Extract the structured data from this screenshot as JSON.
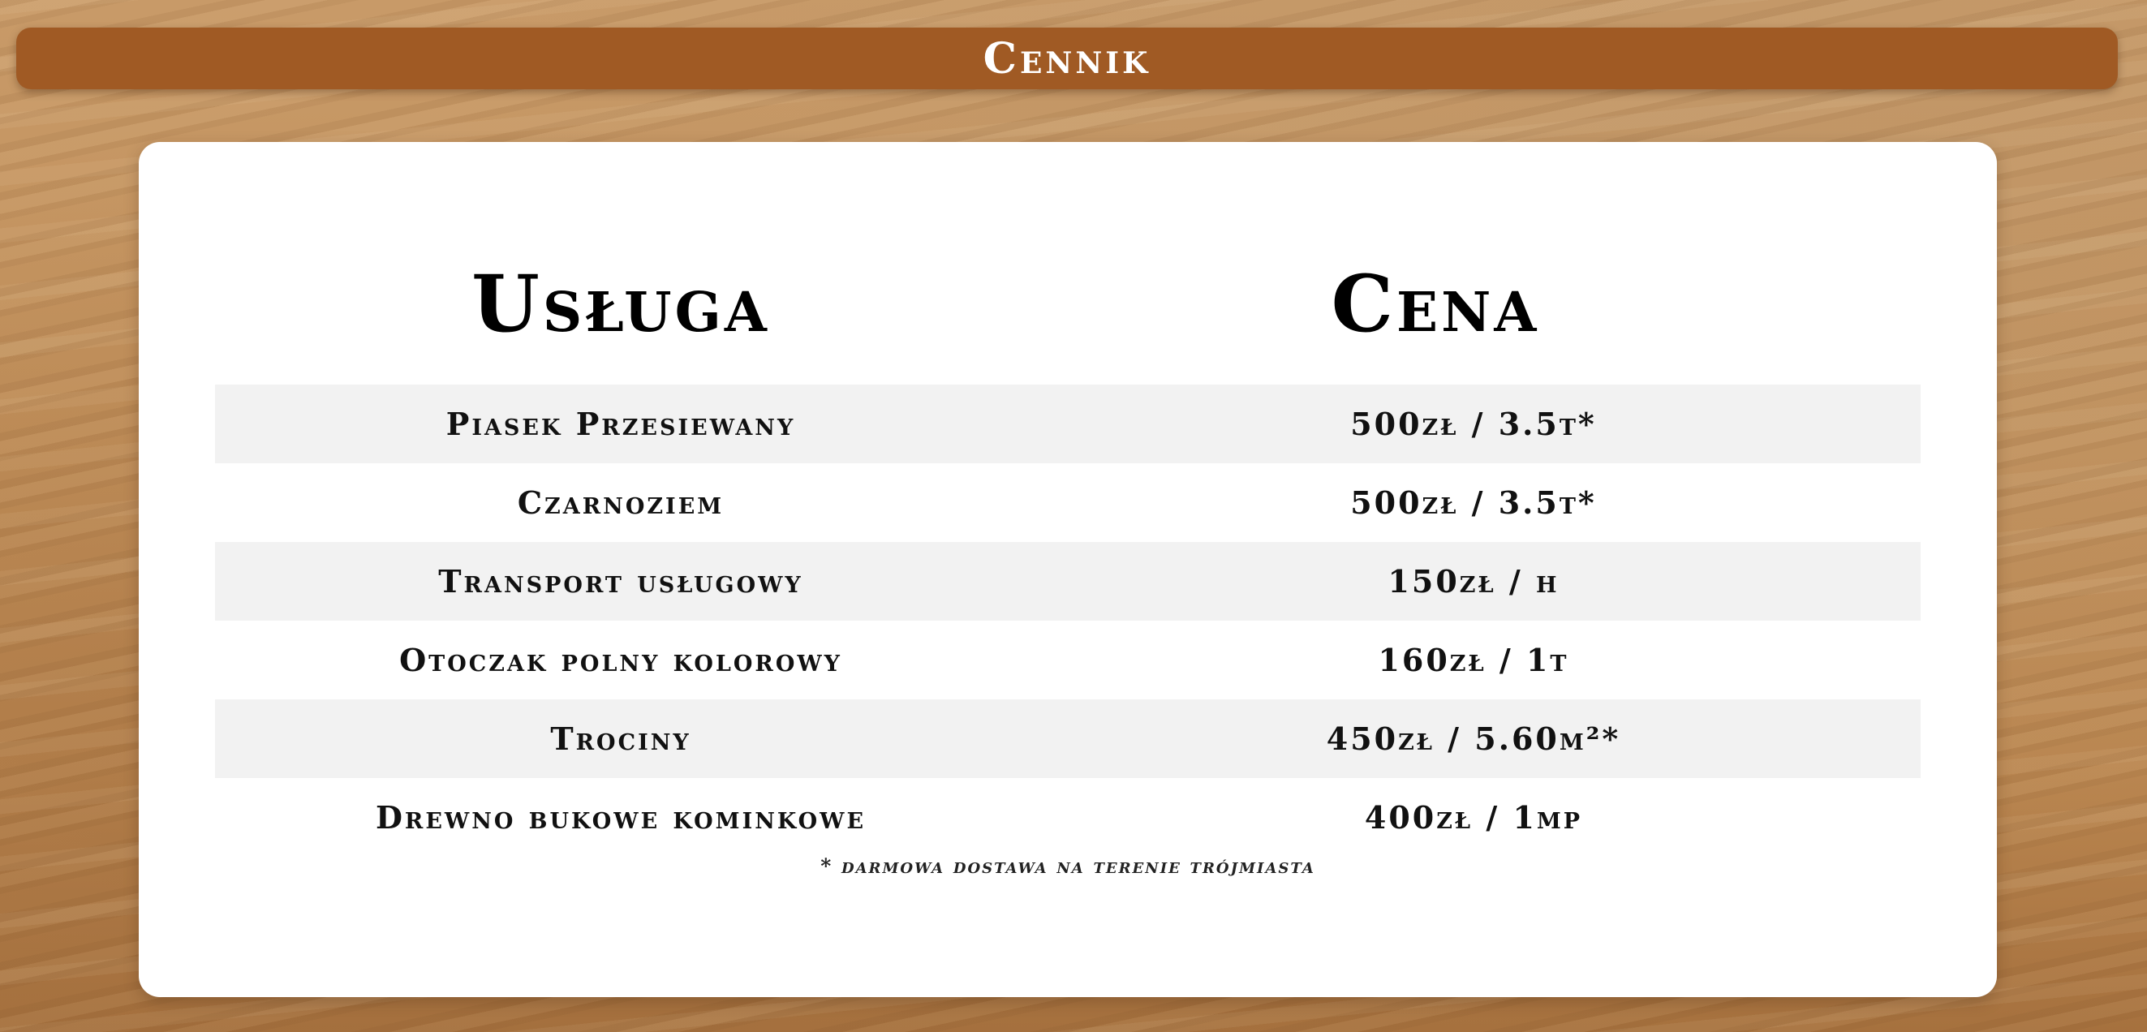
{
  "page": {
    "title": "Cennik"
  },
  "table": {
    "headers": {
      "service": "Usługa",
      "price": "Cena"
    },
    "rows": [
      {
        "service": "Piasek Przesiewany",
        "price": "500zł / 3.5t*"
      },
      {
        "service": "Czarnoziem",
        "price": "500zł / 3.5t*"
      },
      {
        "service": "Transport usługowy",
        "price": "150zł / h"
      },
      {
        "service": "Otoczak polny kolorowy",
        "price": "160zł / 1t"
      },
      {
        "service": "Trociny",
        "price": "450zł / 5.60m²*"
      },
      {
        "service": "Drewno bukowe kominkowe",
        "price": "400zł / 1mp"
      }
    ],
    "footnote": "* darmowa dostawa na terenie trójmiasta"
  },
  "colors": {
    "title_bar": "#a05a24",
    "panel": "#ffffff",
    "row_shade": "#f2f2f2"
  }
}
